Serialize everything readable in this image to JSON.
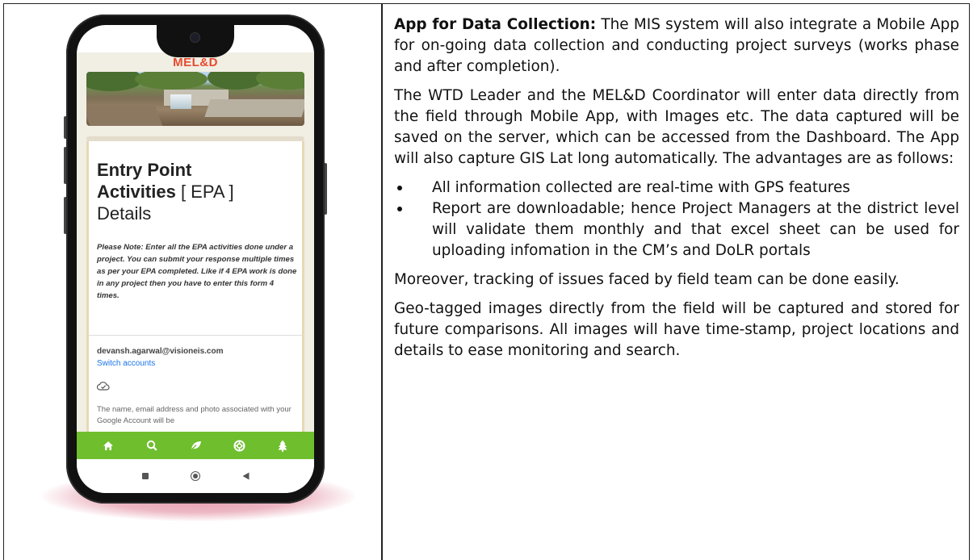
{
  "phone": {
    "app_logo": "MEL&D",
    "title_line1": "Entry Point",
    "title_line2_bold": "Activities",
    "title_line2_light": " [ EPA ]",
    "title_line3": "Details",
    "note": "Please Note: Enter all the EPA activities done under a project. You can submit your response multiple times as per your EPA completed. Like if 4 EPA work is done in any project then you have to enter this form 4 times.",
    "email": "devansh.agarwal@visioneis.com",
    "switch_accounts": "Switch accounts",
    "info": "The name, email address and photo associated with your Google Account will be",
    "nav_icons": [
      "home-icon",
      "search-icon",
      "leaf-icon",
      "lifebuoy-icon",
      "tree-icon"
    ],
    "nav_color": "#6fbe2e",
    "logo_color": "#e64a2e"
  },
  "text": {
    "intro_title": "App for Data Collection:",
    "intro_body": " The MIS system will also integrate a Mobile App for on-going data collection and conducting project surveys (works phase and after completion).",
    "para2": "The WTD Leader and the MEL&D Coordinator will enter data directly from the field through Mobile App, with Images etc. The data captured will be saved on the server, which can be accessed from the Dashboard. The App will also capture GIS Lat long automatically. The advantages are as follows:",
    "bullets": [
      "All information collected are real-time with GPS features",
      "Report are downloadable; hence Project Managers at the district level will validate them monthly and that excel sheet can be used for uploading infomation in the CM’s and DoLR portals"
    ],
    "para3": "Moreover, tracking of issues faced by field team can be done easily.",
    "para4": "Geo-tagged images directly from the field will be captured and stored for future comparisons. All images will have time-stamp, project locations and details to ease monitoring and search."
  }
}
